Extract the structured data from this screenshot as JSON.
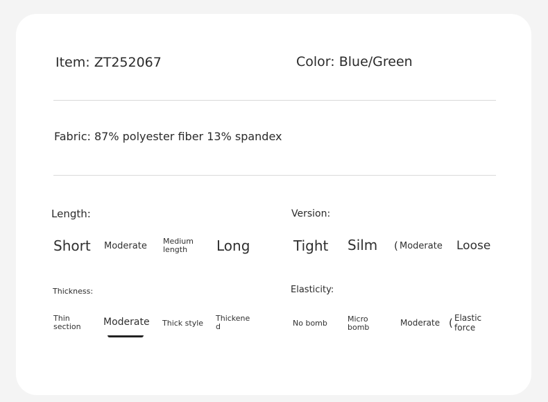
{
  "item": {
    "label": "Item: ZT252067"
  },
  "color": {
    "label": "Color: Blue/Green"
  },
  "fabric": {
    "label": "Fabric: 87% polyester fiber 13% spandex"
  },
  "length": {
    "title": "Length:",
    "options": [
      "Short",
      "Moderate",
      "Medium length",
      "Long"
    ]
  },
  "version": {
    "title": "Version:",
    "options": [
      "Tight",
      "Silm",
      "Moderate",
      "Loose"
    ]
  },
  "thickness": {
    "title": "Thickness:",
    "options": [
      "Thin section",
      "Moderate",
      "Thick style",
      "Thickened"
    ],
    "selected": "Moderate"
  },
  "elasticity": {
    "title": "Elasticity:",
    "options": [
      "No bomb",
      "Micro bomb",
      "Moderate",
      "Elastic force"
    ]
  }
}
